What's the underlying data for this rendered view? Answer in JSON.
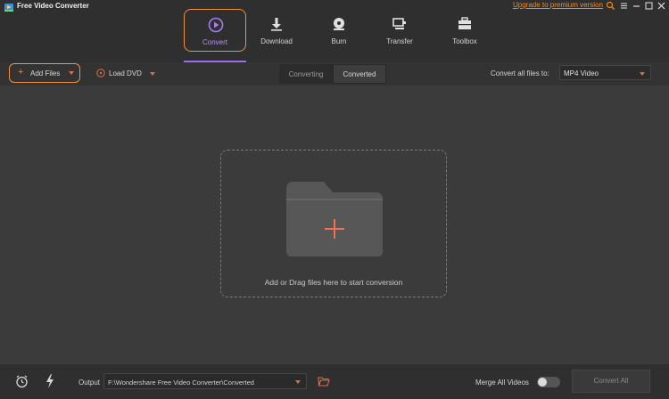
{
  "window": {
    "title": "Free Video Converter",
    "upgrade_link": "Upgrade to premium version"
  },
  "nav": {
    "tabs": [
      {
        "label": "Convert",
        "icon": "convert-play-icon",
        "active": true
      },
      {
        "label": "Download",
        "icon": "download-icon",
        "active": false
      },
      {
        "label": "Burn",
        "icon": "burn-disc-icon",
        "active": false
      },
      {
        "label": "Transfer",
        "icon": "transfer-icon",
        "active": false
      },
      {
        "label": "Toolbox",
        "icon": "toolbox-icon",
        "active": false
      }
    ]
  },
  "toolbar": {
    "add_files": "Add Files",
    "load_dvd": "Load DVD",
    "segments": [
      "Converting",
      "Converted"
    ],
    "selected_segment": "Converted",
    "convert_all_label": "Convert all files to:",
    "format_value": "MP4 Video"
  },
  "main": {
    "drop_text": "Add or Drag files here to start conversion"
  },
  "bottom": {
    "output_label": "Output",
    "output_path": "F:\\Wondershare Free Video Converter\\Converted",
    "merge_label": "Merge All Videos",
    "merge_on": false,
    "convert_all_button": "Convert All"
  },
  "colors": {
    "accent_orange": "#f0913a",
    "accent_purple": "#9b6cf0",
    "background": "#3b3b3b",
    "bar": "#2f2f2f"
  }
}
